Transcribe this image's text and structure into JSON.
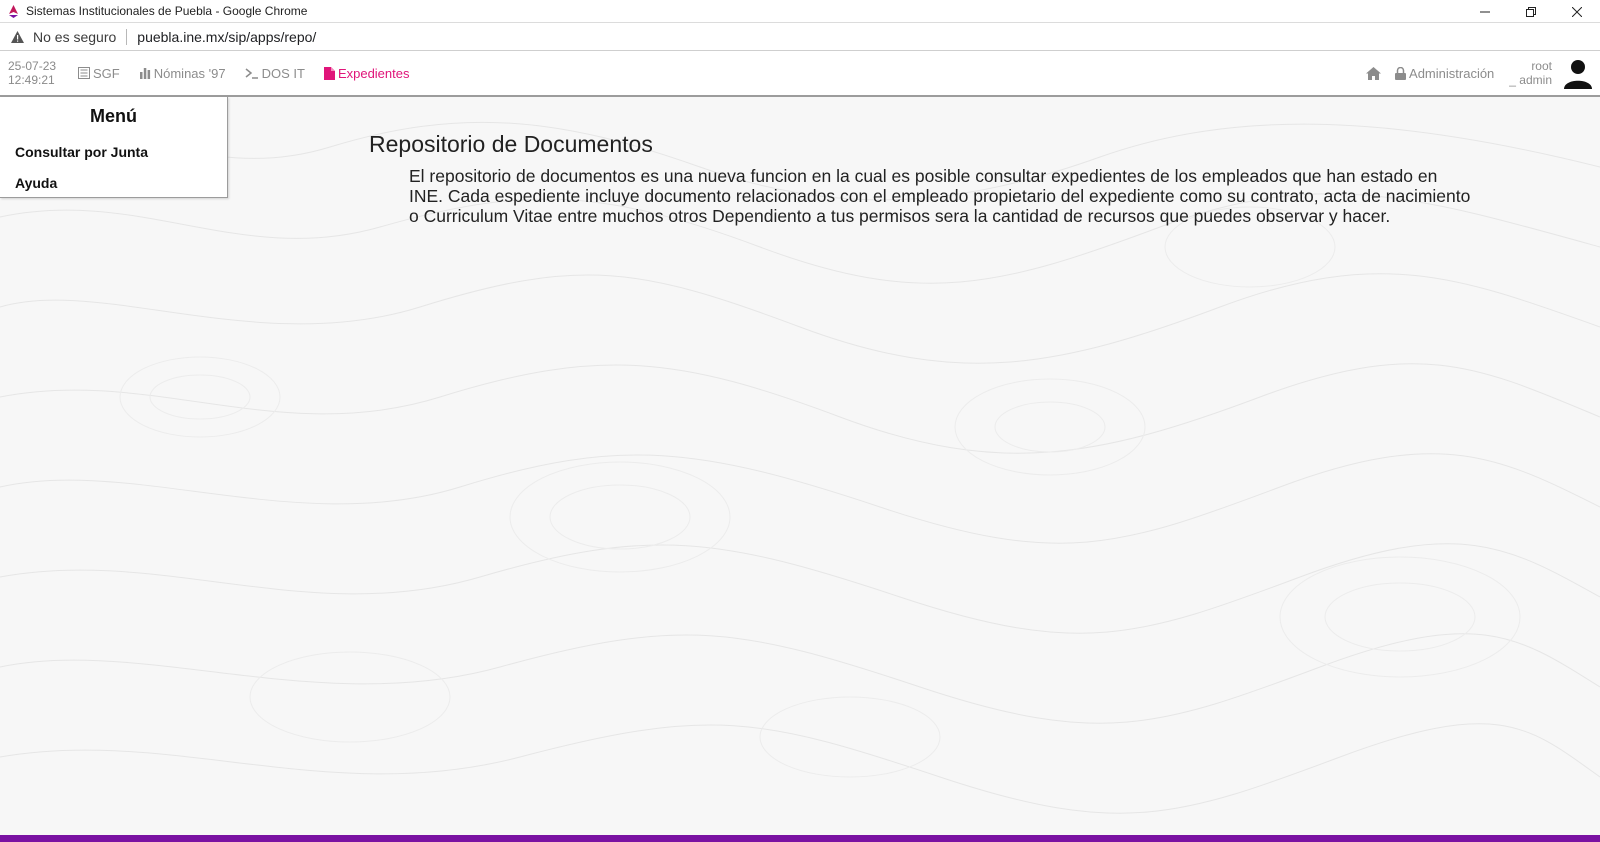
{
  "window": {
    "title": "Sistemas Institucionales de Puebla - Google Chrome",
    "controls": [
      "minimize-icon",
      "restore-icon",
      "close-icon"
    ]
  },
  "addressbar": {
    "security_label": "No es seguro",
    "url": "puebla.ine.mx/sip/apps/repo/"
  },
  "header": {
    "date": "25-07-23",
    "time": "12:49:21",
    "nav": [
      {
        "label": "SGF",
        "icon": "calculator-icon"
      },
      {
        "label": "Nóminas '97",
        "icon": "bar-chart-icon"
      },
      {
        "label": "DOS IT",
        "icon": "terminal-icon"
      },
      {
        "label": "Expedientes",
        "icon": "file-icon",
        "active": true
      }
    ],
    "home_icon": "home-icon",
    "admin_label": "Administración",
    "user_line1": "root",
    "user_line2": "_ admin"
  },
  "menu": {
    "title": "Menú",
    "items": [
      "Consultar por Junta",
      "Ayuda"
    ]
  },
  "content": {
    "title": "Repositorio de Documentos",
    "body": "El repositorio de documentos es una nueva funcion en la cual es posible consultar expedientes de los empleados que han estado en INE. Cada espediente incluye documento relacionados con el empleado propietario del expediente como su contrato, acta de nacimiento o Curriculum Vitae entre muchos otros Dependiento a tus permisos sera la cantidad de recursos que puedes observar y hacer."
  },
  "colors": {
    "accent": "#e0157a",
    "bottom_bar": "#7a12a2",
    "muted_text": "#8c8c8c"
  }
}
